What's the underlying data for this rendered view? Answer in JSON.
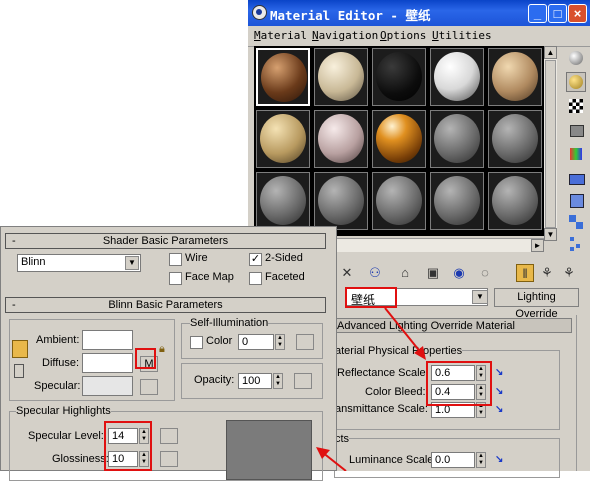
{
  "window": {
    "title": "Material Editor - 壁纸",
    "minimize": "_",
    "maximize": "□",
    "close": "×"
  },
  "menu": [
    "Material",
    "Navigation",
    "Options",
    "Utilities"
  ],
  "sample_slots": [
    {
      "row": 0,
      "col": 0,
      "material": "wood-brown",
      "selected": true
    },
    {
      "row": 0,
      "col": 1,
      "material": "stone-cream"
    },
    {
      "row": 0,
      "col": 2,
      "material": "black"
    },
    {
      "row": 0,
      "col": 3,
      "material": "white"
    },
    {
      "row": 0,
      "col": 4,
      "material": "granite-beige"
    },
    {
      "row": 1,
      "col": 0,
      "material": "spotted-tan"
    },
    {
      "row": 1,
      "col": 1,
      "material": "marble-mauve"
    },
    {
      "row": 1,
      "col": 2,
      "material": "orange-glossy"
    },
    {
      "row": 1,
      "col": 3,
      "material": "default-gray"
    },
    {
      "row": 1,
      "col": 4,
      "material": "default-gray"
    },
    {
      "row": 2,
      "col": 0,
      "material": "default-gray"
    },
    {
      "row": 2,
      "col": 1,
      "material": "default-gray"
    },
    {
      "row": 2,
      "col": 2,
      "material": "default-gray"
    },
    {
      "row": 2,
      "col": 3,
      "material": "default-gray"
    },
    {
      "row": 2,
      "col": 4,
      "material": "default-gray"
    }
  ],
  "material_name": "壁纸",
  "material_type": "Lighting Override",
  "rollout_title": "Advanced Lighting Override Material",
  "physical": {
    "title": "aterial Physical Properties",
    "reflectance_label": "Reflectance Scale:",
    "reflectance_value": "0.6",
    "color_bleed_label": "Color Bleed:",
    "color_bleed_value": "0.4",
    "transmittance_label": "ansmittance Scale:",
    "transmittance_value": "1.0"
  },
  "effects": {
    "title": "cts",
    "luminance_label": "Luminance Scale:",
    "luminance_value": "0.0"
  },
  "shader_basic": {
    "title": "Shader Basic Parameters",
    "collapse": "-",
    "shader": "Blinn",
    "wire": "Wire",
    "two_sided": "2-Sided",
    "face_map": "Face Map",
    "faceted": "Faceted",
    "two_sided_checked": true,
    "check_mark": "✓"
  },
  "blinn_basic": {
    "title": "Blinn Basic Parameters",
    "collapse": "-",
    "ambient": "Ambient:",
    "diffuse": "Diffuse:",
    "specular": "Specular:",
    "map_button": "M",
    "self_illum_title": "Self-Illumination",
    "color_label": "Color",
    "self_illum_value": "0",
    "opacity_label": "Opacity:",
    "opacity_value": "100",
    "spec_highlights_title": "Specular Highlights",
    "spec_level_label": "Specular Level:",
    "spec_level_value": "14",
    "glossiness_label": "Glossiness:",
    "glossiness_value": "10",
    "color_ambient": "#ffffff",
    "color_diffuse": "#ffffff",
    "color_specular": "#e6e6e6"
  },
  "colors": {
    "titlebar": "#0a44c8",
    "highlight_box": "#e01010",
    "panel_bg": "#d4d0c8"
  }
}
